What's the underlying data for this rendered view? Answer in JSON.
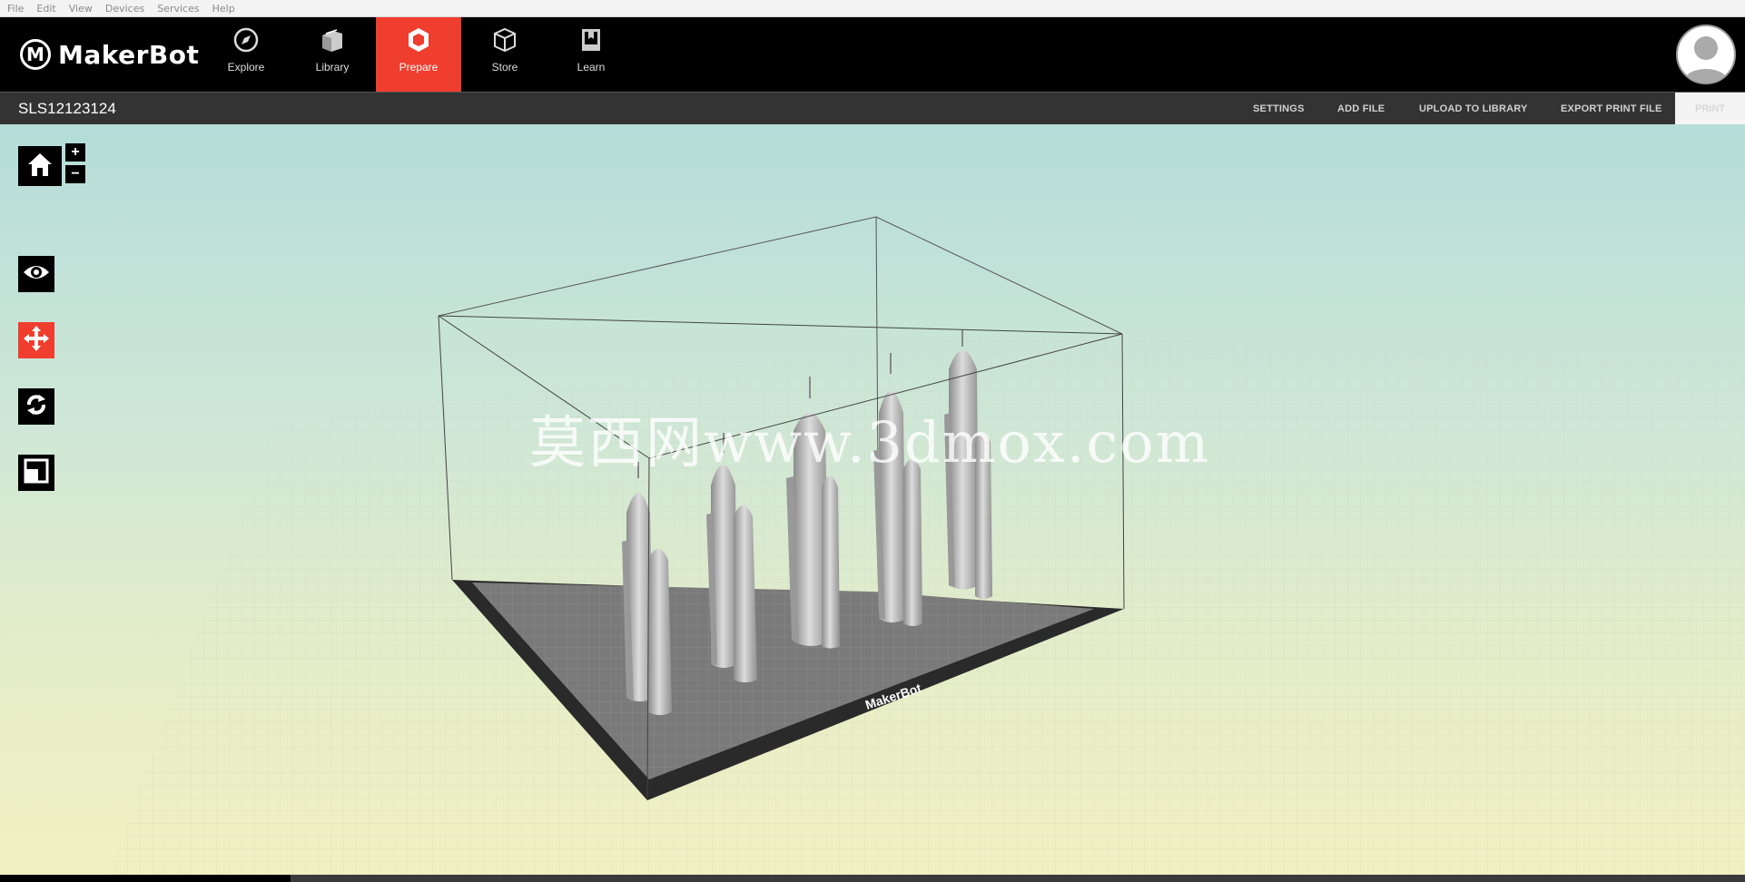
{
  "menubar": {
    "items": [
      "File",
      "Edit",
      "View",
      "Devices",
      "Services",
      "Help"
    ]
  },
  "header": {
    "logo_mark": "M",
    "logo_text": "MakerBot",
    "tabs": [
      {
        "label": "Explore",
        "icon": "compass-icon"
      },
      {
        "label": "Library",
        "icon": "library-icon"
      },
      {
        "label": "Prepare",
        "icon": "prepare-icon",
        "active": true
      },
      {
        "label": "Store",
        "icon": "box-icon"
      },
      {
        "label": "Learn",
        "icon": "book-icon"
      }
    ],
    "avatar_icon": "user-avatar-icon"
  },
  "subbar": {
    "title": "SLS12123124",
    "actions": [
      "SETTINGS",
      "ADD FILE",
      "UPLOAD TO LIBRARY",
      "EXPORT PRINT FILE"
    ],
    "print": "PRINT"
  },
  "tools": {
    "zoom_in": "+",
    "zoom_out": "−",
    "buttons": [
      "home-icon",
      "eye-icon",
      "move-icon",
      "rotate-icon",
      "scale-icon"
    ]
  },
  "viewport": {
    "plate_label": "MakerBot",
    "watermark": "莫西网www.3dmox.com"
  },
  "colors": {
    "accent": "#ef3d2e",
    "header": "#000000",
    "subbar": "#333333"
  }
}
